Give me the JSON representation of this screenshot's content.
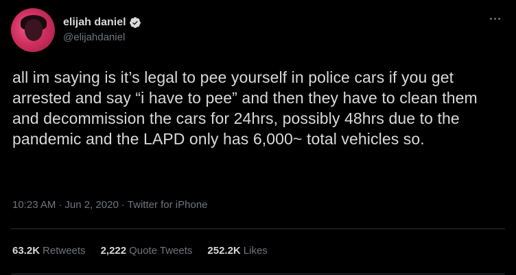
{
  "user": {
    "display_name": "elijah daniel",
    "handle": "@elijahdaniel",
    "verified": true
  },
  "tweet": {
    "text": "all im saying is it’s legal to pee yourself in police cars if you get arrested and say “i have to pee” and then they have to clean them and decommission the cars for 24hrs, possibly 48hrs due to the pandemic and the LAPD only has 6,000~ total vehicles so.",
    "time": "10:23 AM",
    "date": "Jun 2, 2020",
    "source": "Twitter for iPhone",
    "separator": "·"
  },
  "stats": {
    "retweets_count": "63.2K",
    "retweets_label": "Retweets",
    "quotes_count": "2,222",
    "quotes_label": "Quote Tweets",
    "likes_count": "252.2K",
    "likes_label": "Likes"
  },
  "icons": {
    "verified": "verified-badge-icon",
    "more": "more-options-icon"
  },
  "colors": {
    "background": "#000000",
    "text": "#d9d9d9",
    "secondary": "#6e767d",
    "divider": "#2f3336",
    "avatar_accent": "#e0407a"
  }
}
